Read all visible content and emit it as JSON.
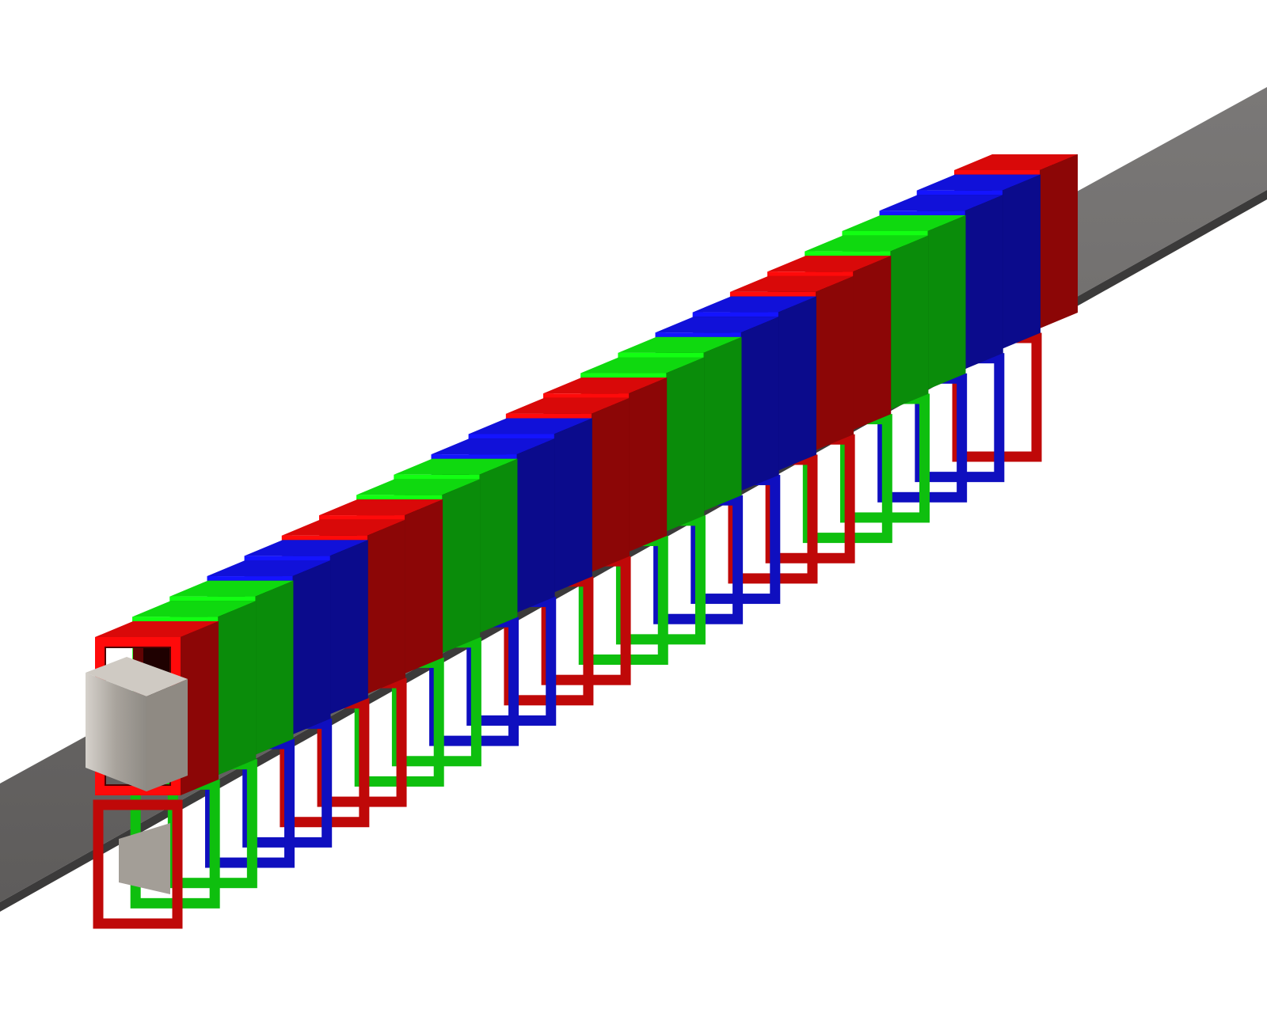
{
  "scene": {
    "kind": "3D render of colored U-shaped loop elements strung along a grey strip",
    "background": "#ffffff",
    "strip_color": "#6b6969",
    "block_color": "#b9b4ad",
    "colors": {
      "red": "#ff0a0a",
      "green": "#12ff12",
      "blue": "#1414ff"
    },
    "loop_sequence": [
      "red",
      "green",
      "green",
      "blue",
      "blue",
      "red",
      "red",
      "green",
      "green",
      "blue",
      "blue",
      "red",
      "red",
      "green",
      "green",
      "blue",
      "blue",
      "red",
      "red",
      "green",
      "green",
      "blue",
      "blue",
      "red"
    ]
  }
}
